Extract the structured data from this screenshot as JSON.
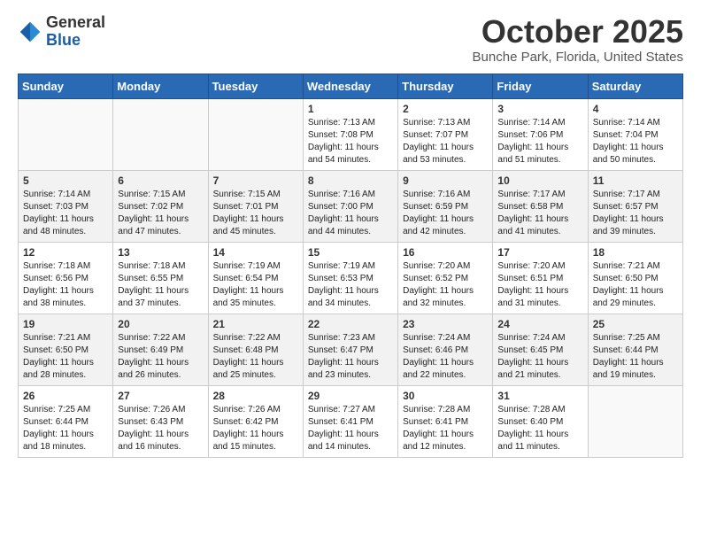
{
  "logo": {
    "general": "General",
    "blue": "Blue"
  },
  "header": {
    "month": "October 2025",
    "location": "Bunche Park, Florida, United States"
  },
  "weekdays": [
    "Sunday",
    "Monday",
    "Tuesday",
    "Wednesday",
    "Thursday",
    "Friday",
    "Saturday"
  ],
  "weeks": [
    [
      {
        "day": "",
        "info": ""
      },
      {
        "day": "",
        "info": ""
      },
      {
        "day": "",
        "info": ""
      },
      {
        "day": "1",
        "info": "Sunrise: 7:13 AM\nSunset: 7:08 PM\nDaylight: 11 hours and 54 minutes."
      },
      {
        "day": "2",
        "info": "Sunrise: 7:13 AM\nSunset: 7:07 PM\nDaylight: 11 hours and 53 minutes."
      },
      {
        "day": "3",
        "info": "Sunrise: 7:14 AM\nSunset: 7:06 PM\nDaylight: 11 hours and 51 minutes."
      },
      {
        "day": "4",
        "info": "Sunrise: 7:14 AM\nSunset: 7:04 PM\nDaylight: 11 hours and 50 minutes."
      }
    ],
    [
      {
        "day": "5",
        "info": "Sunrise: 7:14 AM\nSunset: 7:03 PM\nDaylight: 11 hours and 48 minutes."
      },
      {
        "day": "6",
        "info": "Sunrise: 7:15 AM\nSunset: 7:02 PM\nDaylight: 11 hours and 47 minutes."
      },
      {
        "day": "7",
        "info": "Sunrise: 7:15 AM\nSunset: 7:01 PM\nDaylight: 11 hours and 45 minutes."
      },
      {
        "day": "8",
        "info": "Sunrise: 7:16 AM\nSunset: 7:00 PM\nDaylight: 11 hours and 44 minutes."
      },
      {
        "day": "9",
        "info": "Sunrise: 7:16 AM\nSunset: 6:59 PM\nDaylight: 11 hours and 42 minutes."
      },
      {
        "day": "10",
        "info": "Sunrise: 7:17 AM\nSunset: 6:58 PM\nDaylight: 11 hours and 41 minutes."
      },
      {
        "day": "11",
        "info": "Sunrise: 7:17 AM\nSunset: 6:57 PM\nDaylight: 11 hours and 39 minutes."
      }
    ],
    [
      {
        "day": "12",
        "info": "Sunrise: 7:18 AM\nSunset: 6:56 PM\nDaylight: 11 hours and 38 minutes."
      },
      {
        "day": "13",
        "info": "Sunrise: 7:18 AM\nSunset: 6:55 PM\nDaylight: 11 hours and 37 minutes."
      },
      {
        "day": "14",
        "info": "Sunrise: 7:19 AM\nSunset: 6:54 PM\nDaylight: 11 hours and 35 minutes."
      },
      {
        "day": "15",
        "info": "Sunrise: 7:19 AM\nSunset: 6:53 PM\nDaylight: 11 hours and 34 minutes."
      },
      {
        "day": "16",
        "info": "Sunrise: 7:20 AM\nSunset: 6:52 PM\nDaylight: 11 hours and 32 minutes."
      },
      {
        "day": "17",
        "info": "Sunrise: 7:20 AM\nSunset: 6:51 PM\nDaylight: 11 hours and 31 minutes."
      },
      {
        "day": "18",
        "info": "Sunrise: 7:21 AM\nSunset: 6:50 PM\nDaylight: 11 hours and 29 minutes."
      }
    ],
    [
      {
        "day": "19",
        "info": "Sunrise: 7:21 AM\nSunset: 6:50 PM\nDaylight: 11 hours and 28 minutes."
      },
      {
        "day": "20",
        "info": "Sunrise: 7:22 AM\nSunset: 6:49 PM\nDaylight: 11 hours and 26 minutes."
      },
      {
        "day": "21",
        "info": "Sunrise: 7:22 AM\nSunset: 6:48 PM\nDaylight: 11 hours and 25 minutes."
      },
      {
        "day": "22",
        "info": "Sunrise: 7:23 AM\nSunset: 6:47 PM\nDaylight: 11 hours and 23 minutes."
      },
      {
        "day": "23",
        "info": "Sunrise: 7:24 AM\nSunset: 6:46 PM\nDaylight: 11 hours and 22 minutes."
      },
      {
        "day": "24",
        "info": "Sunrise: 7:24 AM\nSunset: 6:45 PM\nDaylight: 11 hours and 21 minutes."
      },
      {
        "day": "25",
        "info": "Sunrise: 7:25 AM\nSunset: 6:44 PM\nDaylight: 11 hours and 19 minutes."
      }
    ],
    [
      {
        "day": "26",
        "info": "Sunrise: 7:25 AM\nSunset: 6:44 PM\nDaylight: 11 hours and 18 minutes."
      },
      {
        "day": "27",
        "info": "Sunrise: 7:26 AM\nSunset: 6:43 PM\nDaylight: 11 hours and 16 minutes."
      },
      {
        "day": "28",
        "info": "Sunrise: 7:26 AM\nSunset: 6:42 PM\nDaylight: 11 hours and 15 minutes."
      },
      {
        "day": "29",
        "info": "Sunrise: 7:27 AM\nSunset: 6:41 PM\nDaylight: 11 hours and 14 minutes."
      },
      {
        "day": "30",
        "info": "Sunrise: 7:28 AM\nSunset: 6:41 PM\nDaylight: 11 hours and 12 minutes."
      },
      {
        "day": "31",
        "info": "Sunrise: 7:28 AM\nSunset: 6:40 PM\nDaylight: 11 hours and 11 minutes."
      },
      {
        "day": "",
        "info": ""
      }
    ]
  ]
}
